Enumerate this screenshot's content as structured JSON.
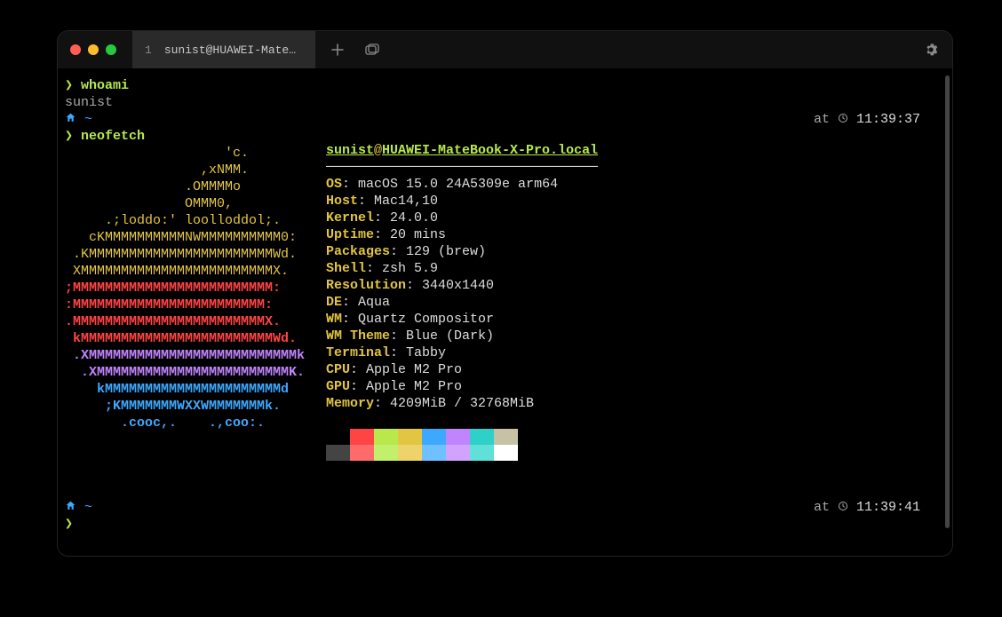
{
  "tab": {
    "index": "1",
    "title": "sunist@HUAWEI-Mate..."
  },
  "prompt": {
    "caret": "❯",
    "apple_icon": "",
    "home_icon": "⌂",
    "tilde": "~",
    "at": "at",
    "clock": "⏱"
  },
  "times": {
    "t1": "11:39:37",
    "t2": "11:39:41"
  },
  "cmds": {
    "whoami": "whoami",
    "whoami_out": "sunist",
    "neofetch": "neofetch"
  },
  "ascii": {
    "l0": "                    'c.",
    "l1": "                 ,xNMM.",
    "l2": "               .OMMMMo",
    "l3": "               OMMM0,",
    "l4": "     .;loddo:' loolloddol;.",
    "l5": "   cKMMMMMMMMMMNWMMMMMMMMMM0:",
    "l6": " .KMMMMMMMMMMMMMMMMMMMMMMMWd.",
    "l7": " XMMMMMMMMMMMMMMMMMMMMMMMMX.",
    "l8": ";MMMMMMMMMMMMMMMMMMMMMMMMM:",
    "l9": ":MMMMMMMMMMMMMMMMMMMMMMMM:",
    "l10": ".MMMMMMMMMMMMMMMMMMMMMMMMX.",
    "l11": " kMMMMMMMMMMMMMMMMMMMMMMMMWd.",
    "l12": " .XMMMMMMMMMMMMMMMMMMMMMMMMMMk",
    "l13": "  .XMMMMMMMMMMMMMMMMMMMMMMMMK.",
    "l14": "    kMMMMMMMMMMMMMMMMMMMMMMd",
    "l15": "     ;KMMMMMMMWXXWMMMMMMMk.",
    "l16": "       .cooc,.    .,coo:."
  },
  "neofetch": {
    "user": "sunist",
    "at": "@",
    "host": "HUAWEI-MateBook-X-Pro.local",
    "hr": "──────────────────────────────────",
    "items": [
      {
        "key": "OS",
        "val": "macOS 15.0 24A5309e arm64"
      },
      {
        "key": "Host",
        "val": "Mac14,10"
      },
      {
        "key": "Kernel",
        "val": "24.0.0"
      },
      {
        "key": "Uptime",
        "val": "20 mins"
      },
      {
        "key": "Packages",
        "val": "129 (brew)"
      },
      {
        "key": "Shell",
        "val": "zsh 5.9"
      },
      {
        "key": "Resolution",
        "val": "3440x1440"
      },
      {
        "key": "DE",
        "val": "Aqua"
      },
      {
        "key": "WM",
        "val": "Quartz Compositor"
      },
      {
        "key": "WM Theme",
        "val": "Blue (Dark)"
      },
      {
        "key": "Terminal",
        "val": "Tabby"
      },
      {
        "key": "CPU",
        "val": "Apple M2 Pro"
      },
      {
        "key": "GPU",
        "val": "Apple M2 Pro"
      },
      {
        "key": "Memory",
        "val": "4209MiB / 32768MiB"
      }
    ],
    "swatches_top": [
      "#000000",
      "#ff4444",
      "#b8e84c",
      "#e2c540",
      "#3ea8ff",
      "#c084fc",
      "#2fd0c8",
      "#c7c1a6"
    ],
    "swatches_bot": [
      "#444444",
      "#ff6b6b",
      "#c3f06a",
      "#edd36a",
      "#6ec0ff",
      "#d1a3ff",
      "#5fe0d8",
      "#ffffff"
    ]
  }
}
